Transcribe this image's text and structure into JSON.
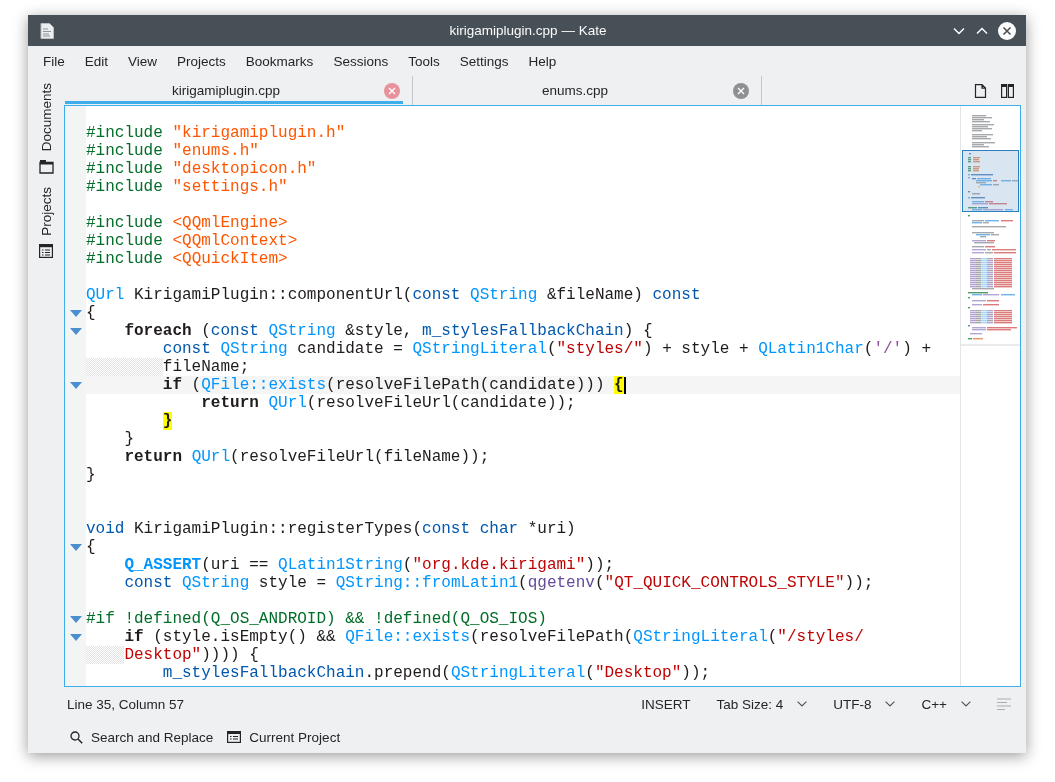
{
  "window": {
    "title": "kirigamiplugin.cpp — Kate"
  },
  "menu_bar": [
    "File",
    "Edit",
    "View",
    "Projects",
    "Bookmarks",
    "Sessions",
    "Tools",
    "Settings",
    "Help"
  ],
  "sidebar": {
    "items": [
      {
        "label": "Documents",
        "selected": false
      },
      {
        "label": "Projects",
        "selected": false
      }
    ]
  },
  "tabs": [
    {
      "label": "kirigamiplugin.cpp",
      "selected": true
    },
    {
      "label": "enums.cpp",
      "selected": false
    }
  ],
  "editor": {
    "lines": [
      {
        "kind": "blank"
      },
      {
        "kind": "code",
        "fold": false,
        "current": false,
        "wrapped": false,
        "tokens": [
          {
            "text": "#include ",
            "kind": "preprocessor"
          },
          {
            "text": "\"kirigamiplugin.h\"",
            "kind": "include"
          }
        ]
      },
      {
        "kind": "code",
        "fold": false,
        "current": false,
        "wrapped": false,
        "tokens": [
          {
            "text": "#include ",
            "kind": "preprocessor"
          },
          {
            "text": "\"enums.h\"",
            "kind": "include"
          }
        ]
      },
      {
        "kind": "code",
        "fold": false,
        "current": false,
        "wrapped": false,
        "tokens": [
          {
            "text": "#include ",
            "kind": "preprocessor"
          },
          {
            "text": "\"desktopicon.h\"",
            "kind": "include"
          }
        ]
      },
      {
        "kind": "code",
        "fold": false,
        "current": false,
        "wrapped": false,
        "tokens": [
          {
            "text": "#include ",
            "kind": "preprocessor"
          },
          {
            "text": "\"settings.h\"",
            "kind": "include"
          }
        ]
      },
      {
        "kind": "blank"
      },
      {
        "kind": "code",
        "fold": false,
        "current": false,
        "wrapped": false,
        "tokens": [
          {
            "text": "#include ",
            "kind": "preprocessor"
          },
          {
            "text": "<QQmlEngine>",
            "kind": "include"
          }
        ]
      },
      {
        "kind": "code",
        "fold": false,
        "current": false,
        "wrapped": false,
        "tokens": [
          {
            "text": "#include ",
            "kind": "preprocessor"
          },
          {
            "text": "<QQmlContext>",
            "kind": "include"
          }
        ]
      },
      {
        "kind": "code",
        "fold": false,
        "current": false,
        "wrapped": false,
        "tokens": [
          {
            "text": "#include ",
            "kind": "preprocessor"
          },
          {
            "text": "<QQuickItem>",
            "kind": "include"
          }
        ]
      },
      {
        "kind": "blank"
      },
      {
        "kind": "code",
        "fold": false,
        "current": false,
        "wrapped": false,
        "tokens": [
          {
            "text": "QUrl",
            "kind": "qt"
          },
          {
            "text": " KirigamiPlugin::componentUrl(",
            "kind": "plain"
          },
          {
            "text": "const ",
            "kind": "type"
          },
          {
            "text": "QString",
            "kind": "qt"
          },
          {
            "text": " &fileName) ",
            "kind": "plain"
          },
          {
            "text": "const",
            "kind": "type"
          }
        ]
      },
      {
        "kind": "code",
        "fold": true,
        "current": false,
        "wrapped": false,
        "tokens": [
          {
            "text": "{",
            "kind": "plain"
          }
        ]
      },
      {
        "kind": "code",
        "fold": true,
        "current": false,
        "wrapped": false,
        "tokens": [
          {
            "text": "    foreach",
            "kind": "keyword"
          },
          {
            "text": " (",
            "kind": "plain"
          },
          {
            "text": "const ",
            "kind": "type"
          },
          {
            "text": "QString",
            "kind": "qt"
          },
          {
            "text": " &style, ",
            "kind": "plain"
          },
          {
            "text": "m_stylesFallbackChain",
            "kind": "member"
          },
          {
            "text": ") {",
            "kind": "plain"
          }
        ]
      },
      {
        "kind": "code",
        "fold": false,
        "current": false,
        "wrapped": false,
        "tokens": [
          {
            "text": "        const ",
            "kind": "type"
          },
          {
            "text": "QString",
            "kind": "qt"
          },
          {
            "text": " candidate = ",
            "kind": "plain"
          },
          {
            "text": "QStringLiteral",
            "kind": "qt"
          },
          {
            "text": "(",
            "kind": "plain"
          },
          {
            "text": "\"styles/\"",
            "kind": "string"
          },
          {
            "text": ") + style + ",
            "kind": "plain"
          },
          {
            "text": "QLatin1Char",
            "kind": "qt"
          },
          {
            "text": "(",
            "kind": "plain"
          },
          {
            "text": "'/'",
            "kind": "char"
          },
          {
            "text": ") +",
            "kind": "plain"
          }
        ]
      },
      {
        "kind": "code",
        "fold": false,
        "current": false,
        "wrapped": true,
        "tokens": [
          {
            "text": "        fileName;",
            "kind": "plain"
          }
        ]
      },
      {
        "kind": "code",
        "fold": true,
        "current": true,
        "wrapped": false,
        "tokens": [
          {
            "text": "        if",
            "kind": "keyword"
          },
          {
            "text": " (",
            "kind": "plain"
          },
          {
            "text": "QFile::exists",
            "kind": "qt"
          },
          {
            "text": "(resolveFilePath(candidate))) ",
            "kind": "plain"
          },
          {
            "text": "{",
            "kind": "bracket"
          }
        ]
      },
      {
        "kind": "code",
        "fold": false,
        "current": false,
        "wrapped": false,
        "tokens": [
          {
            "text": "            return ",
            "kind": "keyword"
          },
          {
            "text": "QUrl",
            "kind": "qt"
          },
          {
            "text": "(resolveFileUrl(candidate));",
            "kind": "plain"
          }
        ]
      },
      {
        "kind": "code",
        "fold": false,
        "current": false,
        "wrapped": false,
        "tokens": [
          {
            "text": "        }",
            "kind": "bracket"
          }
        ]
      },
      {
        "kind": "code",
        "fold": false,
        "current": false,
        "wrapped": false,
        "tokens": [
          {
            "text": "    }",
            "kind": "plain"
          }
        ]
      },
      {
        "kind": "code",
        "fold": false,
        "current": false,
        "wrapped": false,
        "tokens": [
          {
            "text": "    return ",
            "kind": "keyword"
          },
          {
            "text": "QUrl",
            "kind": "qt"
          },
          {
            "text": "(resolveFileUrl(fileName));",
            "kind": "plain"
          }
        ]
      },
      {
        "kind": "code",
        "fold": false,
        "current": false,
        "wrapped": false,
        "tokens": [
          {
            "text": "}",
            "kind": "plain"
          }
        ]
      },
      {
        "kind": "blank"
      },
      {
        "kind": "blank"
      },
      {
        "kind": "code",
        "fold": false,
        "current": false,
        "wrapped": false,
        "tokens": [
          {
            "text": "void",
            "kind": "type"
          },
          {
            "text": " KirigamiPlugin::registerTypes(",
            "kind": "plain"
          },
          {
            "text": "const char",
            "kind": "type"
          },
          {
            "text": " *uri)",
            "kind": "plain"
          }
        ]
      },
      {
        "kind": "code",
        "fold": true,
        "current": false,
        "wrapped": false,
        "tokens": [
          {
            "text": "{",
            "kind": "plain"
          }
        ]
      },
      {
        "kind": "code",
        "fold": false,
        "current": false,
        "wrapped": false,
        "tokens": [
          {
            "text": "    Q_ASSERT",
            "kind": "macro"
          },
          {
            "text": "(uri == ",
            "kind": "plain"
          },
          {
            "text": "QLatin1String",
            "kind": "qt"
          },
          {
            "text": "(",
            "kind": "plain"
          },
          {
            "text": "\"org.kde.kirigami\"",
            "kind": "string"
          },
          {
            "text": "));",
            "kind": "plain"
          }
        ]
      },
      {
        "kind": "code",
        "fold": false,
        "current": false,
        "wrapped": false,
        "tokens": [
          {
            "text": "    const ",
            "kind": "type"
          },
          {
            "text": "QString",
            "kind": "qt"
          },
          {
            "text": " style = ",
            "kind": "plain"
          },
          {
            "text": "QString::fromLatin1",
            "kind": "qt"
          },
          {
            "text": "(",
            "kind": "plain"
          },
          {
            "text": "qgetenv",
            "kind": "function"
          },
          {
            "text": "(",
            "kind": "plain"
          },
          {
            "text": "\"QT_QUICK_CONTROLS_STYLE\"",
            "kind": "string"
          },
          {
            "text": "));",
            "kind": "plain"
          }
        ]
      },
      {
        "kind": "blank"
      },
      {
        "kind": "code",
        "fold": true,
        "current": false,
        "wrapped": false,
        "tokens": [
          {
            "text": "#if !defined(Q_OS_ANDROID) && !defined(Q_OS_IOS)",
            "kind": "preprocessor"
          }
        ]
      },
      {
        "kind": "code",
        "fold": true,
        "current": false,
        "wrapped": false,
        "tokens": [
          {
            "text": "    if",
            "kind": "keyword"
          },
          {
            "text": " (style.isEmpty() && ",
            "kind": "plain"
          },
          {
            "text": "QFile::exists",
            "kind": "qt"
          },
          {
            "text": "(resolveFilePath(",
            "kind": "plain"
          },
          {
            "text": "QStringLiteral",
            "kind": "qt"
          },
          {
            "text": "(",
            "kind": "plain"
          },
          {
            "text": "\"/styles/",
            "kind": "string"
          }
        ]
      },
      {
        "kind": "code",
        "fold": false,
        "current": false,
        "wrapped": true,
        "tokens": [
          {
            "text": "    Desktop\"",
            "kind": "string"
          },
          {
            "text": ")))) {",
            "kind": "plain"
          }
        ]
      },
      {
        "kind": "code",
        "fold": false,
        "current": false,
        "wrapped": false,
        "tokens": [
          {
            "text": "        m_stylesFallbackChain",
            "kind": "member"
          },
          {
            "text": ".prepend(",
            "kind": "plain"
          },
          {
            "text": "QStringLiteral",
            "kind": "qt"
          },
          {
            "text": "(",
            "kind": "plain"
          },
          {
            "text": "\"Desktop\"",
            "kind": "string"
          },
          {
            "text": "));",
            "kind": "plain"
          }
        ]
      }
    ]
  },
  "status_bar": {
    "position": "Line 35, Column 57",
    "mode": "INSERT",
    "dropdowns": [
      "Tab Size: 4",
      "UTF-8",
      "C++"
    ]
  },
  "tool_bar": [
    {
      "label": "Search and Replace",
      "kind": "search"
    },
    {
      "label": "Current Project",
      "kind": "project"
    }
  ]
}
